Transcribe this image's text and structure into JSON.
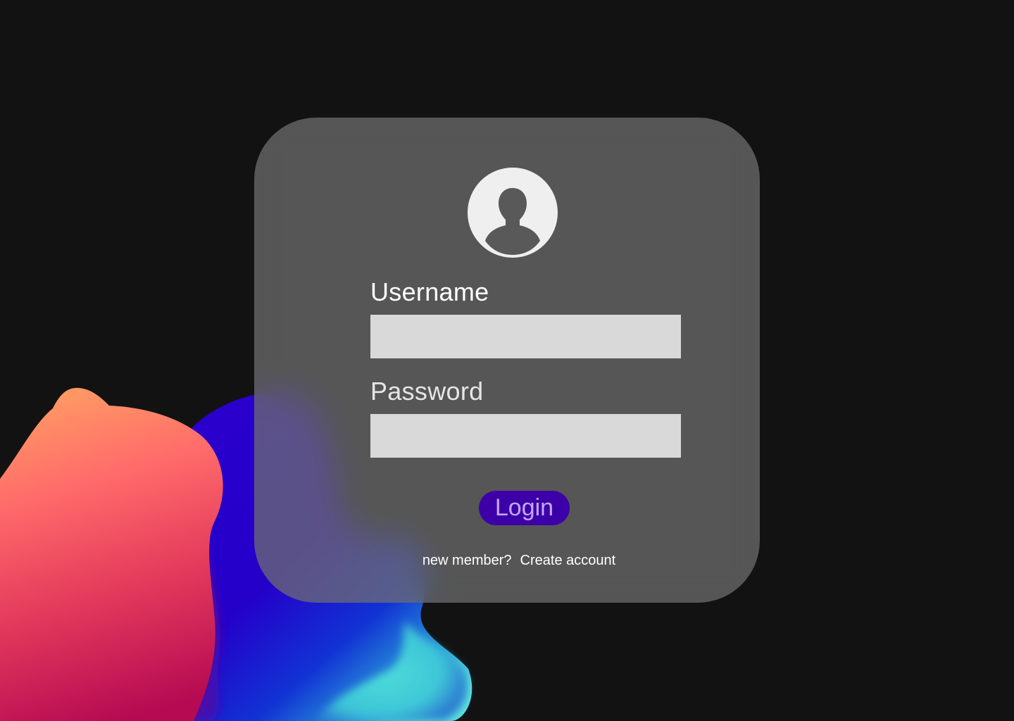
{
  "login_card": {
    "avatar_icon": "user-silhouette-icon",
    "username_label": "Username",
    "username_value": "",
    "password_label": "Password",
    "password_value": "",
    "login_label": "Login",
    "signup_prompt": "new member?",
    "signup_link": "Create account"
  },
  "colors": {
    "background": "#121212",
    "card": "#5c5c5c",
    "input": "#d9d9d9",
    "button": "#3d00a8",
    "button_text": "#c4a6f4",
    "blob_orange": "#ff9a62",
    "blob_red": "#ff5a6b",
    "blob_magenta": "#c9104f",
    "blob_blue": "#2100c8",
    "blob_cyan": "#4ee0d6"
  }
}
